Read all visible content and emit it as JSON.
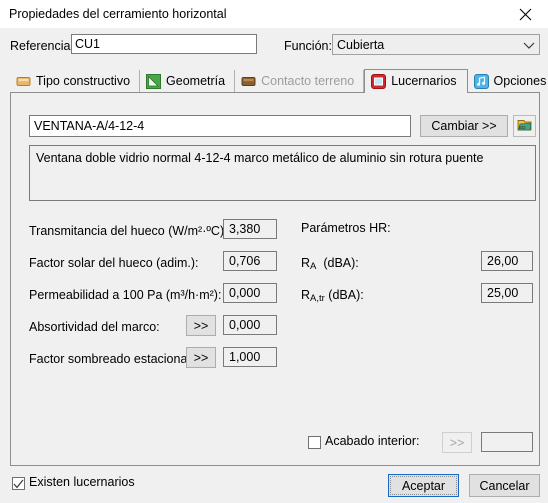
{
  "window": {
    "title": "Propiedades del cerramiento horizontal",
    "close_icon": "close-icon"
  },
  "header": {
    "reference_label": "Referencia:",
    "reference_value": "CU1",
    "reference_placeholder": "",
    "function_label": "Función:",
    "function_value": "Cubierta",
    "function_options": [
      "Cubierta"
    ],
    "chevron_icon": "chevron-down-icon"
  },
  "tabs": [
    {
      "label": "Tipo constructivo",
      "icon": "orange-block-icon",
      "selected": false,
      "disabled": false
    },
    {
      "label": "Geometría",
      "icon": "green-triangle-icon",
      "selected": false,
      "disabled": false
    },
    {
      "label": "Contacto terreno",
      "icon": "brown-block-icon",
      "selected": false,
      "disabled": true
    },
    {
      "label": "Lucernarios",
      "icon": "red-skylight-icon",
      "selected": true,
      "disabled": false
    },
    {
      "label": "Opciones HR",
      "icon": "blue-music-note-icon",
      "selected": false,
      "disabled": false
    }
  ],
  "panel": {
    "element_name": "VENTANA-A/4-12-4",
    "element_name_placeholder": "",
    "change_button": "Cambiar >>",
    "library_button_icon": "library-folder-icon",
    "description": "Ventana doble vidrio normal 4-12-4 marco metálico de aluminio sin rotura puente",
    "params": [
      {
        "label": "Transmitancia del hueco (W/m²·ºC):",
        "value": "3,380",
        "has_arrows": false
      },
      {
        "label": "Factor solar del hueco (adim.):",
        "value": "0,706",
        "has_arrows": false
      },
      {
        "label": "Permeabilidad a 100 Pa (m³/h·m²):",
        "value": "0,000",
        "has_arrows": false
      },
      {
        "label": "Absortividad del marco:",
        "value": "0,000",
        "has_arrows": true,
        "arrows_label": ">>"
      },
      {
        "label": "Factor sombreado estacional:",
        "value": "1,000",
        "has_arrows": true,
        "arrows_label": ">>"
      }
    ],
    "hr": {
      "title": "Parámetros HR:",
      "ra_label_main": "R",
      "ra_label_sub": "A",
      "ra_label_unit": "(dBA):",
      "ra_value": "26,00",
      "ratr_label_main": "R",
      "ratr_label_sub": "A,tr",
      "ratr_label_unit": "(dBA):",
      "ratr_value": "25,00",
      "finish_checkbox_label": "Acabado interior:",
      "finish_checked": false,
      "finish_arrows_label": ">>",
      "finish_value": ""
    }
  },
  "footer": {
    "skylights_checkbox_label": "Existen lucernarios",
    "skylights_checked": true,
    "accept_label": "Aceptar",
    "cancel_label": "Cancelar"
  },
  "colors": {
    "dialog_bg": "#f0f0f0",
    "titlebar_bg": "#ffffff",
    "field_border": "#7a7a7a",
    "button_bg": "#e1e1e1",
    "focus_border": "#1569c7",
    "disabled_text": "#9d9d9d",
    "tab_red": "#d8252a",
    "tab_green": "#49a845",
    "tab_orange": "#e8b765",
    "tab_brown": "#8b5e33",
    "tab_blue": "#4fb3e8"
  }
}
